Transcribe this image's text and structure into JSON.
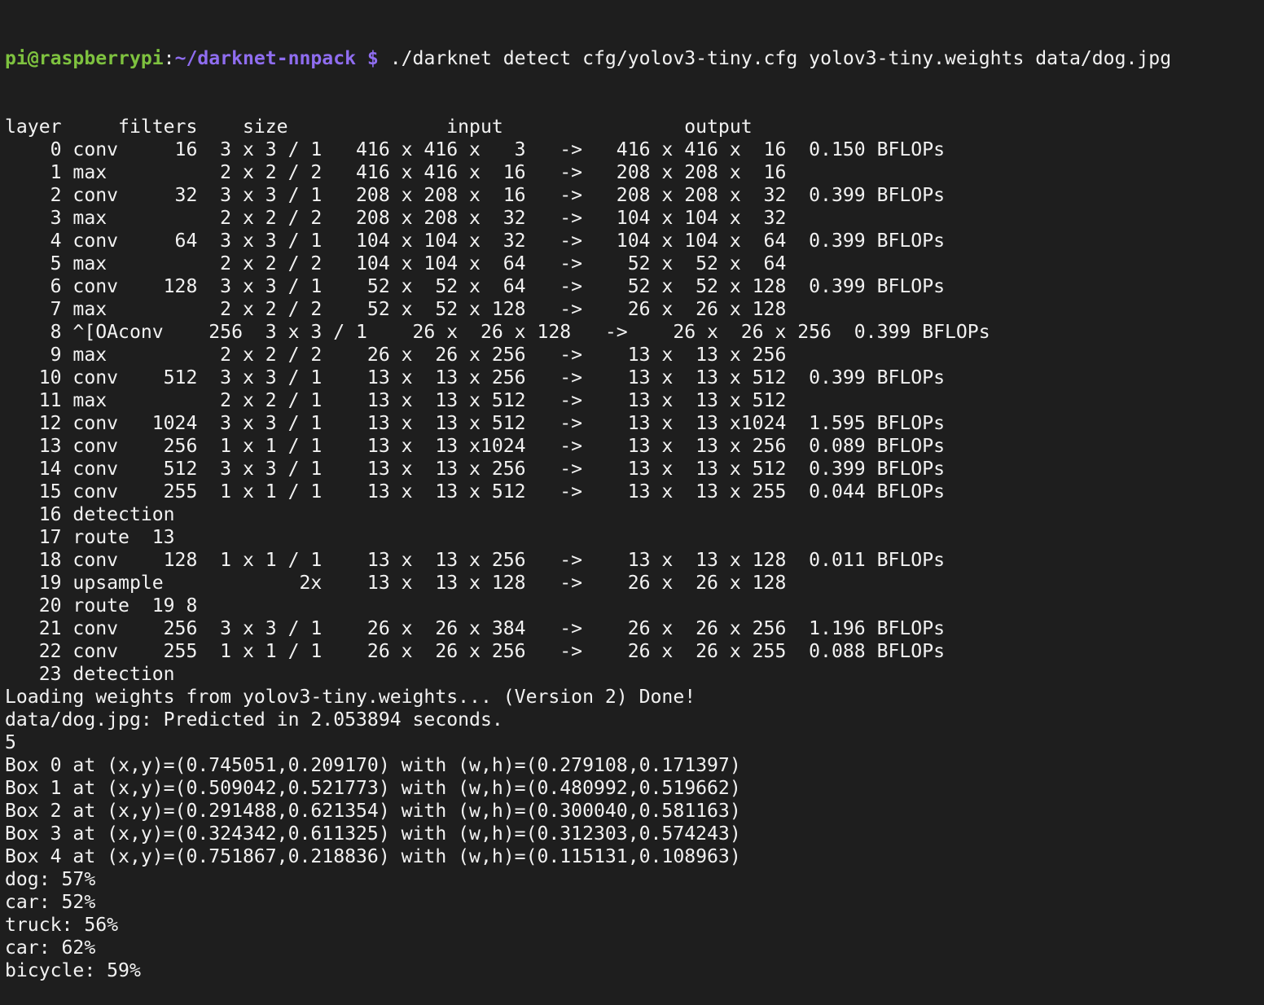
{
  "prompt": {
    "user_host": "pi@raspberrypi",
    "separator": ":",
    "path": "~/darknet-nnpack",
    "symbol": " $",
    "command": " ./darknet detect cfg/yolov3-tiny.cfg yolov3-tiny.weights data/dog.jpg"
  },
  "colors": {
    "background": "#1e1e1e",
    "text": "#f2f2f2",
    "user_host": "#7ec23f",
    "path": "#8f6df0"
  },
  "output_lines": [
    "layer     filters    size              input                output",
    "    0 conv     16  3 x 3 / 1   416 x 416 x   3   ->   416 x 416 x  16  0.150 BFLOPs",
    "    1 max          2 x 2 / 2   416 x 416 x  16   ->   208 x 208 x  16",
    "    2 conv     32  3 x 3 / 1   208 x 208 x  16   ->   208 x 208 x  32  0.399 BFLOPs",
    "    3 max          2 x 2 / 2   208 x 208 x  32   ->   104 x 104 x  32",
    "    4 conv     64  3 x 3 / 1   104 x 104 x  32   ->   104 x 104 x  64  0.399 BFLOPs",
    "    5 max          2 x 2 / 2   104 x 104 x  64   ->    52 x  52 x  64",
    "    6 conv    128  3 x 3 / 1    52 x  52 x  64   ->    52 x  52 x 128  0.399 BFLOPs",
    "    7 max          2 x 2 / 2    52 x  52 x 128   ->    26 x  26 x 128",
    "    8 ^[OAconv    256  3 x 3 / 1    26 x  26 x 128   ->    26 x  26 x 256  0.399 BFLOPs",
    "    9 max          2 x 2 / 2    26 x  26 x 256   ->    13 x  13 x 256",
    "   10 conv    512  3 x 3 / 1    13 x  13 x 256   ->    13 x  13 x 512  0.399 BFLOPs",
    "   11 max          2 x 2 / 1    13 x  13 x 512   ->    13 x  13 x 512",
    "   12 conv   1024  3 x 3 / 1    13 x  13 x 512   ->    13 x  13 x1024  1.595 BFLOPs",
    "   13 conv    256  1 x 1 / 1    13 x  13 x1024   ->    13 x  13 x 256  0.089 BFLOPs",
    "   14 conv    512  3 x 3 / 1    13 x  13 x 256   ->    13 x  13 x 512  0.399 BFLOPs",
    "   15 conv    255  1 x 1 / 1    13 x  13 x 512   ->    13 x  13 x 255  0.044 BFLOPs",
    "   16 detection",
    "   17 route  13",
    "   18 conv    128  1 x 1 / 1    13 x  13 x 256   ->    13 x  13 x 128  0.011 BFLOPs",
    "   19 upsample            2x    13 x  13 x 128   ->    26 x  26 x 128",
    "   20 route  19 8",
    "   21 conv    256  3 x 3 / 1    26 x  26 x 384   ->    26 x  26 x 256  1.196 BFLOPs",
    "   22 conv    255  1 x 1 / 1    26 x  26 x 256   ->    26 x  26 x 255  0.088 BFLOPs",
    "   23 detection",
    "Loading weights from yolov3-tiny.weights... (Version 2) Done!",
    "data/dog.jpg: Predicted in 2.053894 seconds.",
    "5",
    "Box 0 at (x,y)=(0.745051,0.209170) with (w,h)=(0.279108,0.171397)",
    "Box 1 at (x,y)=(0.509042,0.521773) with (w,h)=(0.480992,0.519662)",
    "Box 2 at (x,y)=(0.291488,0.621354) with (w,h)=(0.300040,0.581163)",
    "Box 3 at (x,y)=(0.324342,0.611325) with (w,h)=(0.312303,0.574243)",
    "Box 4 at (x,y)=(0.751867,0.218836) with (w,h)=(0.115131,0.108963)",
    "dog: 57%",
    "car: 52%",
    "truck: 56%",
    "car: 62%",
    "bicycle: 59%"
  ]
}
